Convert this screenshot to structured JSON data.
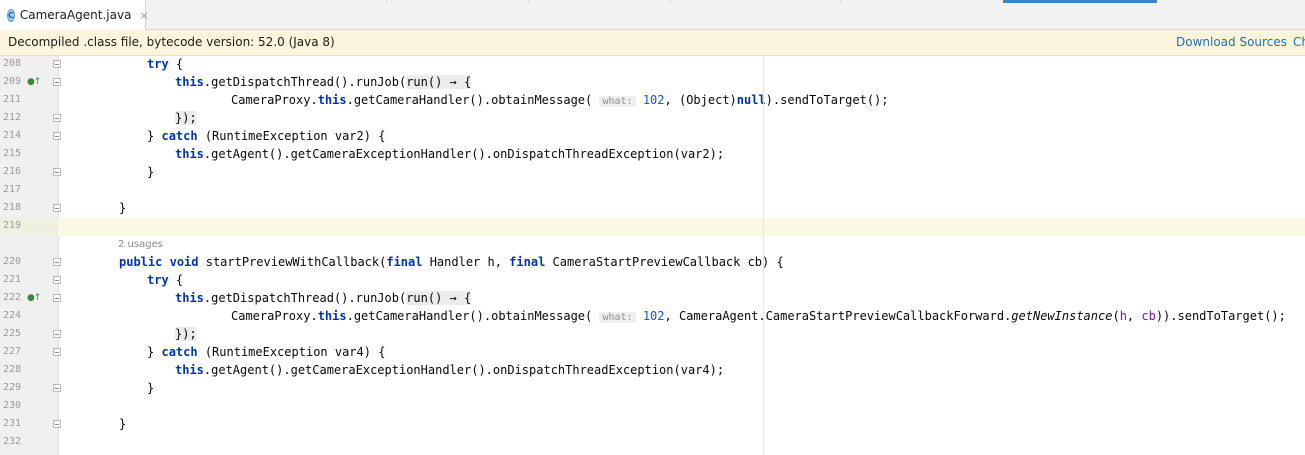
{
  "tab": {
    "icon": "class-file-icon",
    "icon_glyph": "C",
    "title": "CameraAgent.java",
    "close": "×"
  },
  "banner": {
    "text": "Decompiled .class file, bytecode version: 52.0 (Java 8)",
    "download_sources": "Download Sources",
    "choose_sources": "Ch"
  },
  "usages": "2 usages",
  "lines": [
    {
      "num": "208"
    },
    {
      "num": "209"
    },
    {
      "num": "211"
    },
    {
      "num": "212"
    },
    {
      "num": "214"
    },
    {
      "num": "215"
    },
    {
      "num": "216"
    },
    {
      "num": "217"
    },
    {
      "num": "218"
    },
    {
      "num": "219"
    },
    {
      "num": "220"
    },
    {
      "num": "221"
    },
    {
      "num": "222"
    },
    {
      "num": "224"
    },
    {
      "num": "225"
    },
    {
      "num": "227"
    },
    {
      "num": "228"
    },
    {
      "num": "229"
    },
    {
      "num": "230"
    },
    {
      "num": "231"
    },
    {
      "num": "232"
    }
  ],
  "code": {
    "try": "try",
    "catch": "catch",
    "this": "this",
    "null": "null",
    "public": "public",
    "void": "void",
    "final": "final",
    "run_job": ".getDispatchThread().runJob(",
    "lambda": "run() → {",
    "camera_proxy": "CameraProxy.",
    "obtain_message": ".getCameraHandler().obtainMessage(",
    "what_hint": "what:",
    "what_value": "102",
    "object_cast": ", (Object)",
    "send_tail": ").sendToTarget();",
    "close_lambda": "});",
    "open_brace": " {",
    "close_brace": "}",
    "catch_var2": " (RuntimeException var2) {",
    "catch_var4": " (RuntimeException var4) {",
    "get_agent": ".getAgent().getCameraExceptionHandler().onDispatchThreadException(",
    "var2_end": "var2);",
    "var4_end": "var4);",
    "method_name": " startPreviewWithCallback(",
    "param_h": " Handler h, ",
    "param_cb": " CameraStartPreviewCallback cb) {",
    "forward_class": ", CameraAgent.CameraStartPreviewCallbackForward.",
    "get_new_instance": "getNewInstance",
    "args_open": "(",
    "arg_h": "h",
    "arg_sep": ", ",
    "arg_cb": "cb",
    "send_tail2": ")).sendToTarget();"
  },
  "colors": {
    "keyword": "#0033b3",
    "number": "#1750eb",
    "banner_bg": "#fcf5dc",
    "link": "#2470b3",
    "current_line": "#fcf9e3"
  }
}
